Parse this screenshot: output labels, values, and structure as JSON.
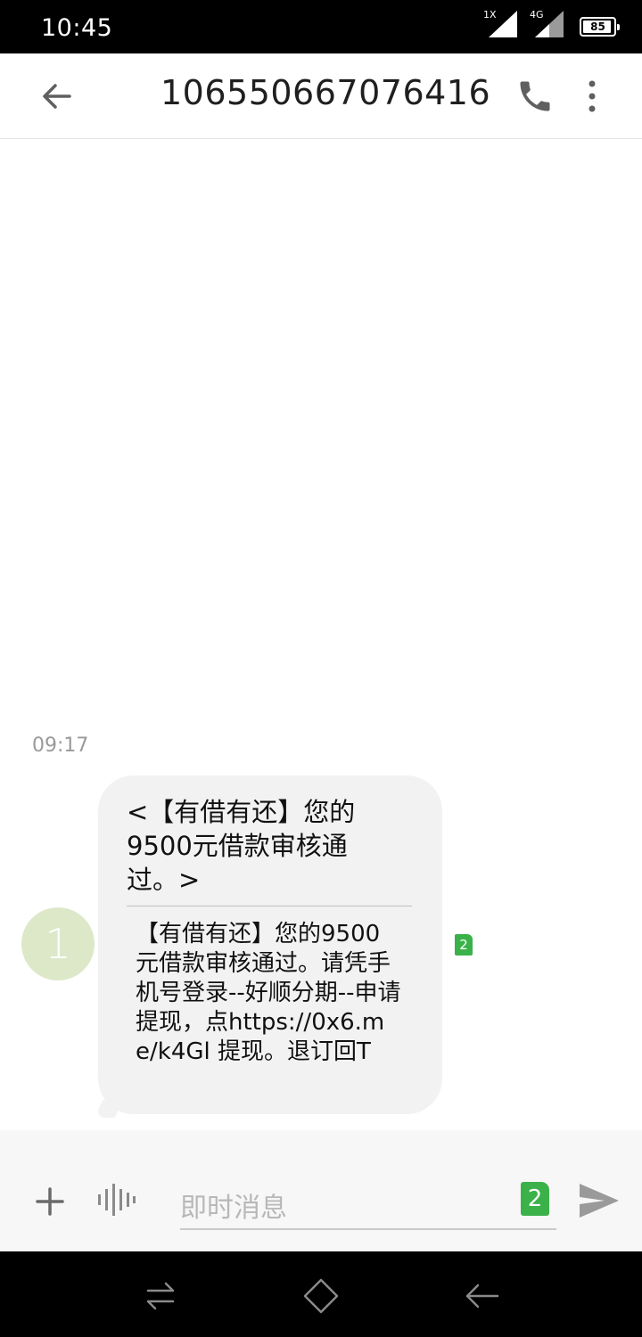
{
  "status_bar": {
    "time": "10:45",
    "signal1_label": "1X",
    "signal2_label": "4G",
    "battery_level": 85,
    "battery_text": "85"
  },
  "app_bar": {
    "title": "106550667076416",
    "back_icon": "arrow-left-icon",
    "call_icon": "phone-icon",
    "more_icon": "more-vertical-icon"
  },
  "conversation": {
    "timestamp": "09:17",
    "avatar_letter": "1",
    "message": {
      "subject": "<【有借有还】您的9500元借款审核通过。>",
      "body": "【有借有还】您的9500元借款审核通过。请凭手机号登录--好顺分期--申请提现，点https://0x6.me/k4Gl 提现。退订回T",
      "sim_slot": "2"
    }
  },
  "composer": {
    "placeholder": "即时消息",
    "sim_slot": "2",
    "plus_icon": "plus-icon",
    "voice_icon": "voice-wave-icon",
    "send_icon": "send-icon"
  },
  "nav_bar": {
    "icons": [
      "switch-icon",
      "home-icon",
      "back-icon"
    ]
  },
  "colors": {
    "accent_green": "#3bb14a",
    "bubble_bg": "#f2f2f2",
    "avatar_bg": "#dde8c9"
  }
}
